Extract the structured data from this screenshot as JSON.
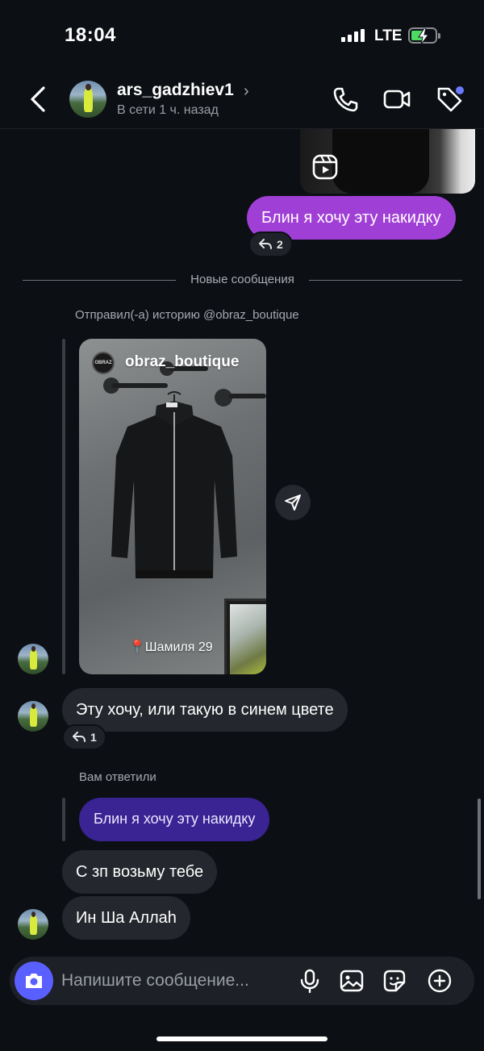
{
  "status_bar": {
    "time": "18:04",
    "network": "LTE"
  },
  "header": {
    "username": "ars_gadzhiev1",
    "presence": "В сети 1 ч. назад"
  },
  "messages": {
    "sent_text": "Блин я хочу эту накидку",
    "sent_reactions": "2",
    "divider": "Новые сообщения",
    "story_caption": "Отправил(-а) историю @obraz_boutique",
    "story": {
      "account": "obraz_boutique",
      "logo_text": "OBRAZ",
      "location": "📍Шамиля 29"
    },
    "reply1_text": "Эту хочу, или такую в синем цвете",
    "reply1_reactions": "1",
    "replied_label": "Вам ответили",
    "quoted_text": "Блин я хочу эту накидку",
    "msg2": "С зп возьму тебе",
    "msg3": "Ин Ша Аллаh"
  },
  "composer": {
    "placeholder": "Напишите сообщение..."
  },
  "colors": {
    "sent_bubble": "#a03fd6",
    "received_bubble": "#24272d",
    "quote_bubble": "#3a2393",
    "camera_button": "#5a5fff"
  }
}
